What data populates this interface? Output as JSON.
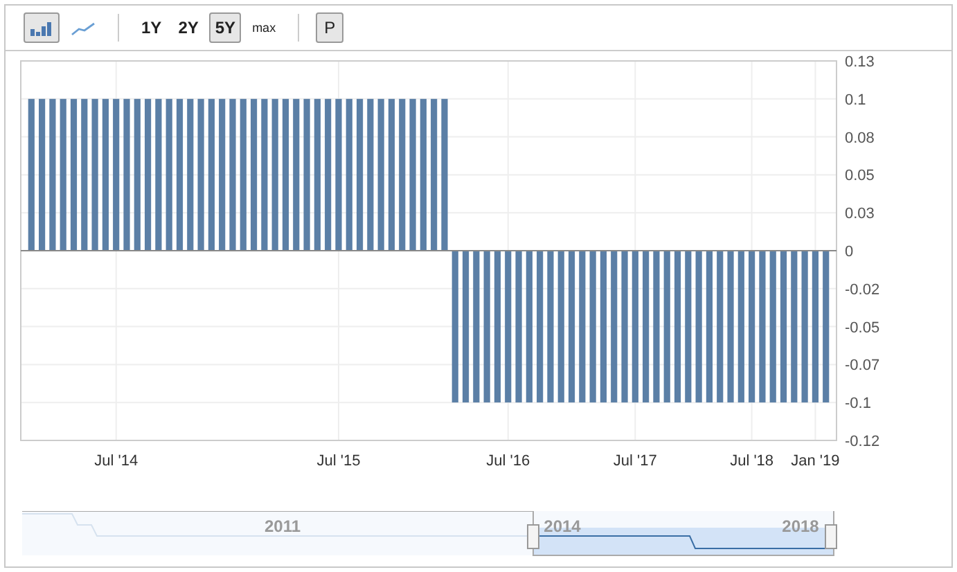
{
  "toolbar": {
    "chart_types": [
      {
        "kind": "bar",
        "selected": true
      },
      {
        "kind": "line",
        "selected": false
      }
    ],
    "ranges": [
      {
        "label": "1Y",
        "selected": false
      },
      {
        "label": "2Y",
        "selected": false
      },
      {
        "label": "5Y",
        "selected": true
      },
      {
        "label": "max",
        "selected": false
      }
    ],
    "print_button": "P"
  },
  "chart": {
    "chart_data": {
      "type": "bar",
      "grid": true,
      "categories": [
        null,
        null,
        null,
        null,
        null,
        null,
        null,
        null,
        "Jul '14",
        null,
        null,
        null,
        null,
        null,
        null,
        null,
        null,
        null,
        null,
        null,
        null,
        null,
        null,
        null,
        null,
        null,
        null,
        null,
        null,
        "Jul '15",
        null,
        null,
        null,
        null,
        null,
        null,
        null,
        null,
        null,
        null,
        null,
        null,
        null,
        null,
        null,
        "Jul '16",
        null,
        null,
        null,
        null,
        null,
        null,
        null,
        null,
        null,
        null,
        null,
        "Jul '17",
        null,
        null,
        null,
        null,
        null,
        null,
        null,
        null,
        null,
        null,
        "Jul '18",
        null,
        null,
        null,
        null,
        null,
        "Jan '19",
        null
      ],
      "series": [
        {
          "color": "#5b7fa6",
          "values": [
            0.1,
            0.1,
            0.1,
            0.1,
            0.1,
            0.1,
            0.1,
            0.1,
            0.1,
            0.1,
            0.1,
            0.1,
            0.1,
            0.1,
            0.1,
            0.1,
            0.1,
            0.1,
            0.1,
            0.1,
            0.1,
            0.1,
            0.1,
            0.1,
            0.1,
            0.1,
            0.1,
            0.1,
            0.1,
            0.1,
            0.1,
            0.1,
            0.1,
            0.1,
            0.1,
            0.1,
            0.1,
            0.1,
            0.1,
            0.1,
            -0.1,
            -0.1,
            -0.1,
            -0.1,
            -0.1,
            -0.1,
            -0.1,
            -0.1,
            -0.1,
            -0.1,
            -0.1,
            -0.1,
            -0.1,
            -0.1,
            -0.1,
            -0.1,
            -0.1,
            -0.1,
            -0.1,
            -0.1,
            -0.1,
            -0.1,
            -0.1,
            -0.1,
            -0.1,
            -0.1,
            -0.1,
            -0.1,
            -0.1,
            -0.1,
            -0.1,
            -0.1,
            -0.1,
            -0.1,
            -0.1,
            -0.1
          ]
        }
      ],
      "ylim": [
        -0.125,
        0.125
      ],
      "yticks": [
        {
          "value": 0.125,
          "label": "0.13"
        },
        {
          "value": 0.1,
          "label": "0.1"
        },
        {
          "value": 0.075,
          "label": "0.08"
        },
        {
          "value": 0.05,
          "label": "0.05"
        },
        {
          "value": 0.025,
          "label": "0.03"
        },
        {
          "value": 0,
          "label": "0"
        },
        {
          "value": -0.025,
          "label": "-0.02"
        },
        {
          "value": -0.05,
          "label": "-0.05"
        },
        {
          "value": -0.075,
          "label": "-0.07"
        },
        {
          "value": -0.1,
          "label": "-0.1"
        },
        {
          "value": -0.125,
          "label": "-0.12"
        }
      ]
    }
  },
  "navigator": {
    "labels": [
      "2011",
      "2014",
      "2018"
    ]
  }
}
